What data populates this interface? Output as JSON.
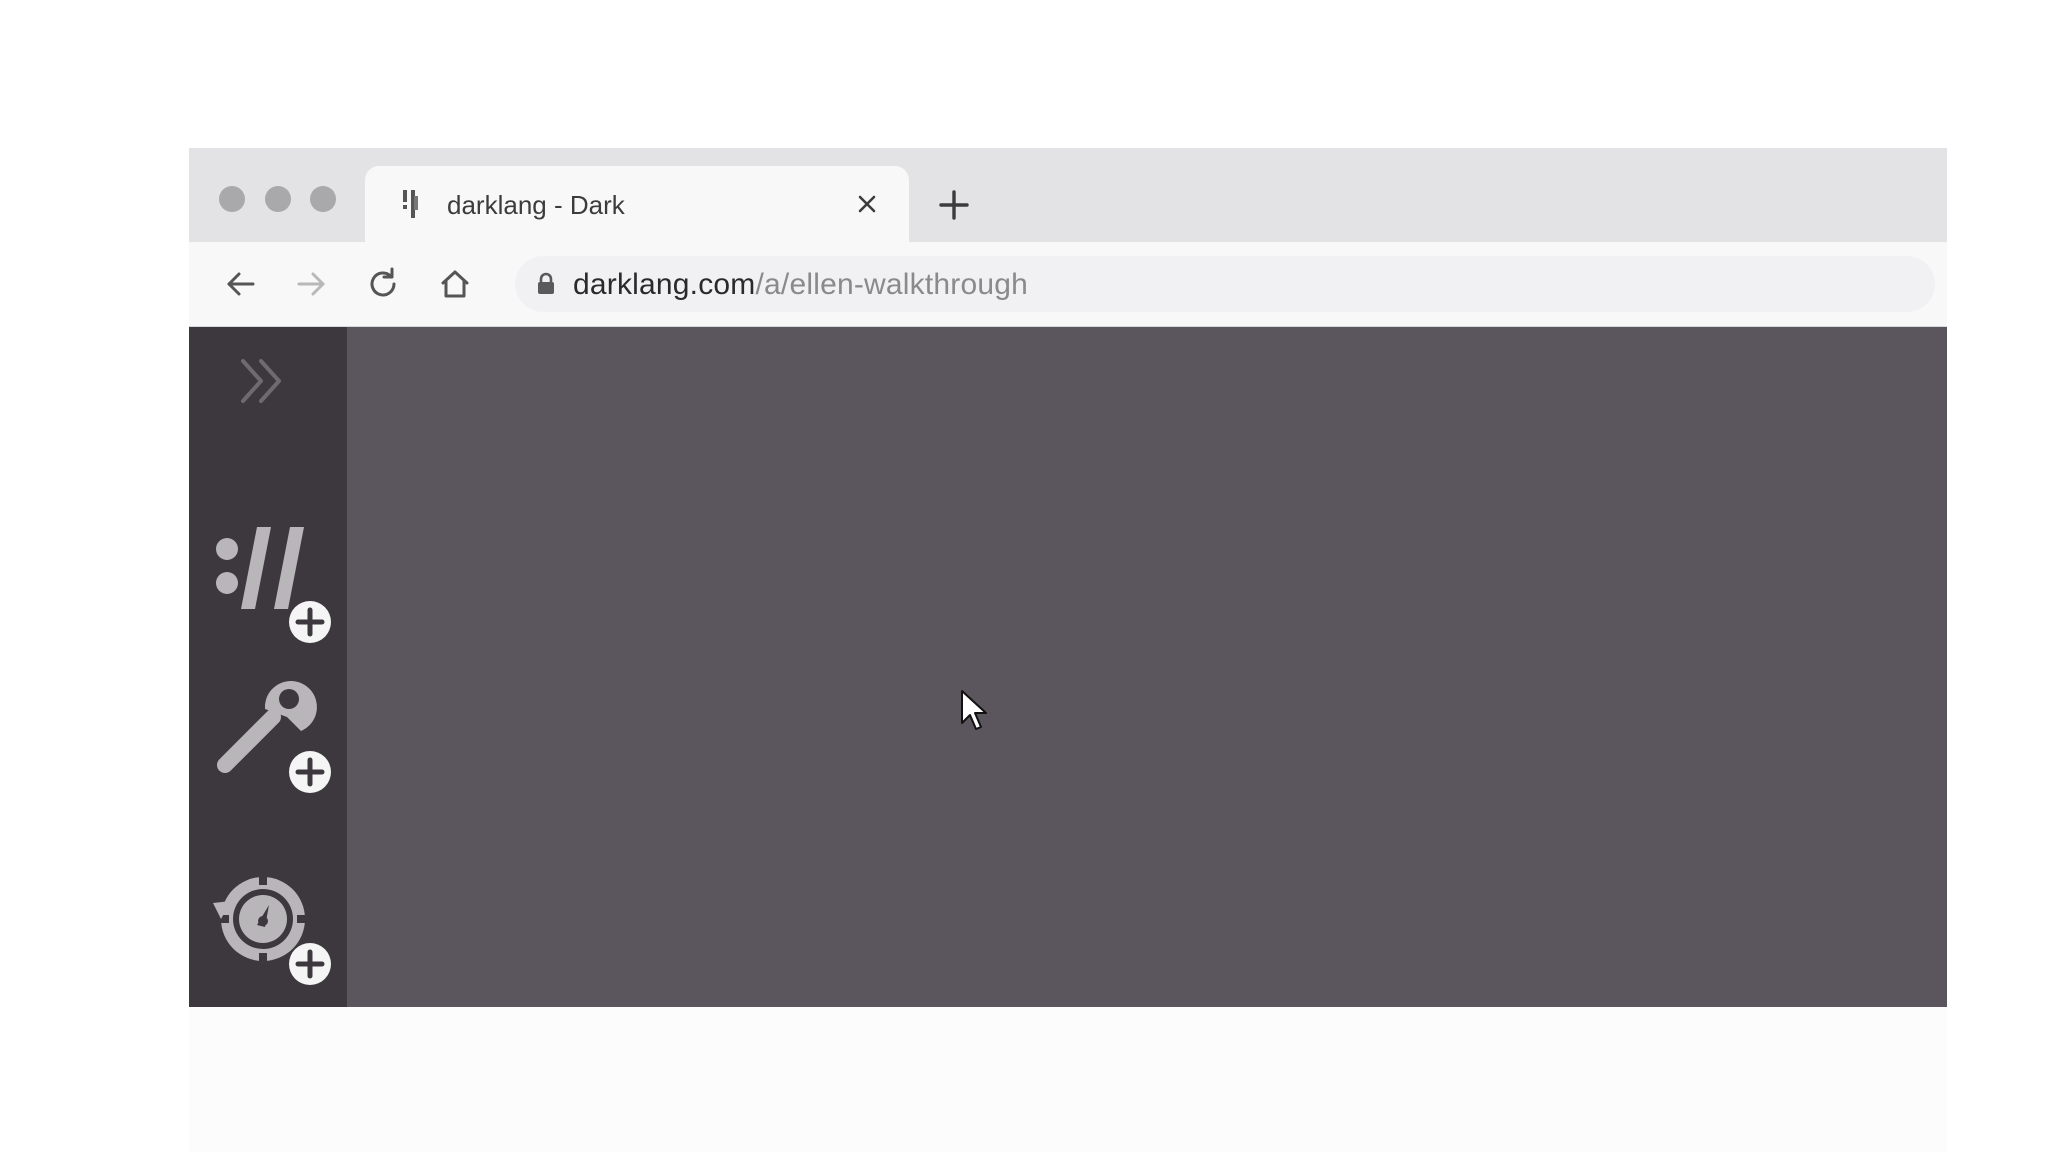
{
  "browser": {
    "tab": {
      "title": "darklang - Dark"
    },
    "address_bar": {
      "host": "darklang.com",
      "path": "/a/ellen-walkthrough"
    }
  },
  "icons": {
    "back": "arrow-left-icon",
    "forward": "arrow-right-icon",
    "reload": "reload-icon",
    "home": "home-icon",
    "lock": "lock-icon",
    "close": "close-icon",
    "new_tab": "plus-icon",
    "sidebar_toggle": "double-chevron-right-icon",
    "http_handler": "http-handler-icon",
    "function": "wrench-icon",
    "cron": "cron-icon",
    "add": "plus-circle-icon"
  },
  "colors": {
    "canvas": "#5b565d",
    "sidebar": "#3d383e",
    "sidebar_icon": "#b9b6ba",
    "toggle_icon": "#6f6a70"
  }
}
